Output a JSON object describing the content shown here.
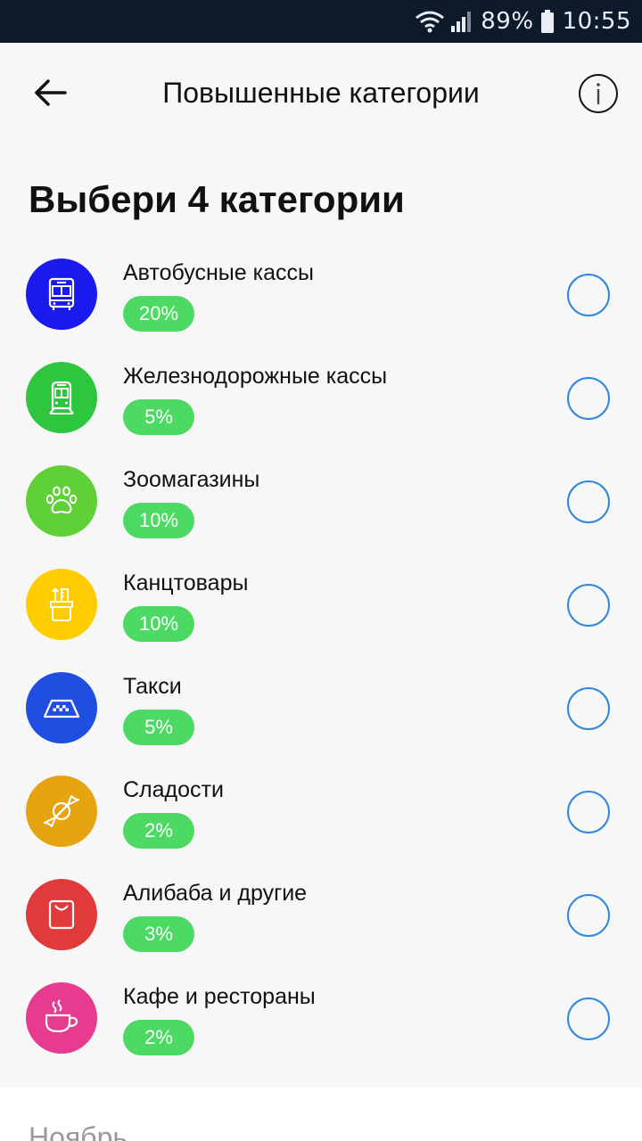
{
  "status_bar": {
    "battery": "89%",
    "time": "10:55",
    "icons": [
      "wifi-icon",
      "signal-icon",
      "battery-icon"
    ]
  },
  "app_bar": {
    "title": "Повышенные категории",
    "back_icon": "arrow-left-icon",
    "info_icon": "info-icon"
  },
  "headline": "Выбери 4 категории",
  "categories": [
    {
      "name": "Автобусные кассы",
      "percent": "20%",
      "icon": "bus-icon",
      "color": "#1a1aee",
      "selected": false
    },
    {
      "name": "Железнодорожные кассы",
      "percent": "5%",
      "icon": "train-icon",
      "color": "#2ec53f",
      "selected": false
    },
    {
      "name": "Зоомагазины",
      "percent": "10%",
      "icon": "paw-icon",
      "color": "#5fd136",
      "selected": false
    },
    {
      "name": "Канцтовары",
      "percent": "10%",
      "icon": "stationery-icon",
      "color": "#ffcc00",
      "selected": false
    },
    {
      "name": "Такси",
      "percent": "5%",
      "icon": "taxi-icon",
      "color": "#1f4ee0",
      "selected": false
    },
    {
      "name": "Сладости",
      "percent": "2%",
      "icon": "candy-icon",
      "color": "#e6a410",
      "selected": false
    },
    {
      "name": "Алибаба и другие",
      "percent": "3%",
      "icon": "shopping-bag-icon",
      "color": "#e03a3a",
      "selected": false
    },
    {
      "name": "Кафе и рестораны",
      "percent": "2%",
      "icon": "coffee-cup-icon",
      "color": "#e63b8f",
      "selected": false
    }
  ],
  "footer": {
    "month": "Ноябрь"
  },
  "colors": {
    "badge": "#4cd964",
    "radio": "#2f86de",
    "status_bar_bg": "#0c1a2b",
    "background": "#f7f7f7"
  }
}
